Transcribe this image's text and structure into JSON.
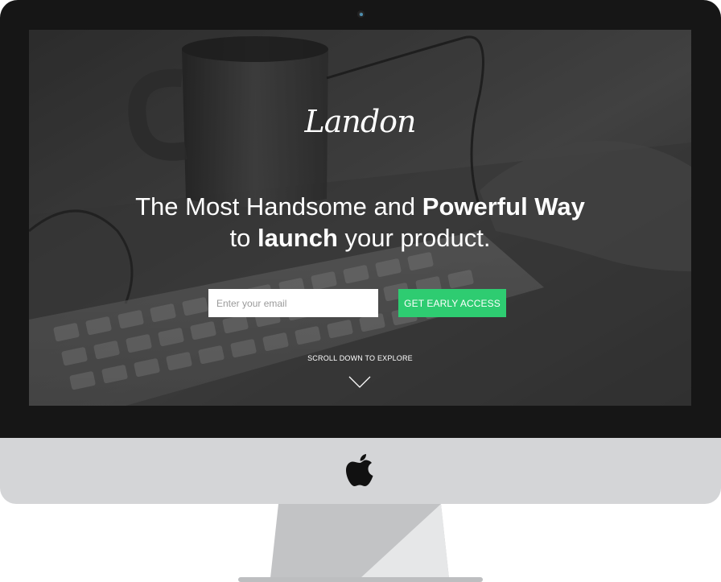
{
  "brand": {
    "logo_text": "Landon"
  },
  "hero": {
    "headline_part1": "The Most Handsome and ",
    "headline_bold1": "Powerful Way",
    "headline_part2": "to ",
    "headline_bold2": "launch",
    "headline_part3": " your product."
  },
  "signup": {
    "email_placeholder": "Enter your email",
    "email_value": "",
    "cta_label": "GET EARLY ACCESS"
  },
  "scroll": {
    "label": "SCROLL DOWN TO EXPLORE",
    "icon": "chevron-down-icon"
  },
  "device": {
    "frame": "imac",
    "logo_icon": "apple-logo-icon"
  },
  "colors": {
    "accent": "#2ecc71",
    "bezel": "#161616",
    "chin": "#d4d5d7",
    "text": "#ffffff"
  }
}
